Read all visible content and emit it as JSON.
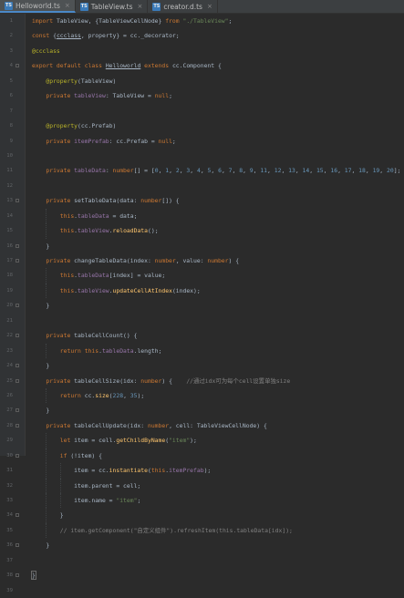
{
  "tabs": [
    {
      "icon": "TS",
      "label": "Helloworld.ts",
      "active": true
    },
    {
      "icon": "TS",
      "label": "TableView.ts",
      "active": false
    },
    {
      "icon": "TS",
      "label": "creator.d.ts",
      "active": false
    }
  ],
  "code_lines": [
    {
      "n": "1",
      "tokens": [
        [
          "kw",
          "import"
        ],
        [
          "p",
          " TableView, {TableViewCellNode} "
        ],
        [
          "kw",
          "from"
        ],
        [
          "p",
          " "
        ],
        [
          "str",
          "\"./TableView\""
        ],
        [
          "p",
          ";"
        ]
      ]
    },
    {
      "n": "2",
      "tokens": [
        [
          "kw",
          "const"
        ],
        [
          "p",
          " {"
        ],
        [
          "ul",
          "ccclass"
        ],
        [
          "p",
          ", property} = cc._decorator;"
        ]
      ]
    },
    {
      "n": "3",
      "tokens": [
        [
          "dec",
          "@ccclass"
        ]
      ]
    },
    {
      "n": "4",
      "tokens": [
        [
          "kw",
          "export default class "
        ],
        [
          "ul",
          "Helloworld"
        ],
        [
          "kw",
          " extends "
        ],
        [
          "p",
          "cc.Component {"
        ]
      ]
    },
    {
      "n": "5",
      "tokens": [
        [
          "p",
          "    "
        ],
        [
          "dec",
          "@property"
        ],
        [
          "p",
          "(TableView)"
        ]
      ]
    },
    {
      "n": "6",
      "tokens": [
        [
          "p",
          "    "
        ],
        [
          "kw",
          "private "
        ],
        [
          "prop",
          "tableView"
        ],
        [
          "p",
          ": TableView = "
        ],
        [
          "kw",
          "null"
        ],
        [
          "p",
          ";"
        ]
      ]
    },
    {
      "n": "7",
      "tokens": [
        [
          "p",
          ""
        ]
      ]
    },
    {
      "n": "8",
      "tokens": [
        [
          "p",
          "    "
        ],
        [
          "dec",
          "@property"
        ],
        [
          "p",
          "(cc.Prefab)"
        ]
      ]
    },
    {
      "n": "9",
      "tokens": [
        [
          "p",
          "    "
        ],
        [
          "kw",
          "private "
        ],
        [
          "prop",
          "itemPrefab"
        ],
        [
          "p",
          ": cc.Prefab = "
        ],
        [
          "kw",
          "null"
        ],
        [
          "p",
          ";"
        ]
      ]
    },
    {
      "n": "10",
      "tokens": [
        [
          "p",
          ""
        ]
      ]
    },
    {
      "n": "11",
      "tokens": [
        [
          "p",
          "    "
        ],
        [
          "kw",
          "private "
        ],
        [
          "prop",
          "tableData"
        ],
        [
          "p",
          ": "
        ],
        [
          "kw",
          "number"
        ],
        [
          "p",
          "[] = ["
        ],
        [
          "num",
          "0"
        ],
        [
          "p",
          ", "
        ],
        [
          "num",
          "1"
        ],
        [
          "p",
          ", "
        ],
        [
          "num",
          "2"
        ],
        [
          "p",
          ", "
        ],
        [
          "num",
          "3"
        ],
        [
          "p",
          ", "
        ],
        [
          "num",
          "4"
        ],
        [
          "p",
          ", "
        ],
        [
          "num",
          "5"
        ],
        [
          "p",
          ", "
        ],
        [
          "num",
          "6"
        ],
        [
          "p",
          ", "
        ],
        [
          "num",
          "7"
        ],
        [
          "p",
          ", "
        ],
        [
          "num",
          "8"
        ],
        [
          "p",
          ", "
        ],
        [
          "num",
          "9"
        ],
        [
          "p",
          ", "
        ],
        [
          "num",
          "11"
        ],
        [
          "p",
          ", "
        ],
        [
          "num",
          "12"
        ],
        [
          "p",
          ", "
        ],
        [
          "num",
          "13"
        ],
        [
          "p",
          ", "
        ],
        [
          "num",
          "14"
        ],
        [
          "p",
          ", "
        ],
        [
          "num",
          "15"
        ],
        [
          "p",
          ", "
        ],
        [
          "num",
          "16"
        ],
        [
          "p",
          ", "
        ],
        [
          "num",
          "17"
        ],
        [
          "p",
          ", "
        ],
        [
          "num",
          "18"
        ],
        [
          "p",
          ", "
        ],
        [
          "num",
          "19"
        ],
        [
          "p",
          ", "
        ],
        [
          "num",
          "20"
        ],
        [
          "p",
          "];"
        ]
      ]
    },
    {
      "n": "12",
      "tokens": [
        [
          "p",
          ""
        ]
      ]
    },
    {
      "n": "13",
      "tokens": [
        [
          "p",
          "    "
        ],
        [
          "kw",
          "private "
        ],
        [
          "p",
          "setTableData(data: "
        ],
        [
          "kw",
          "number"
        ],
        [
          "p",
          "[]) {"
        ]
      ]
    },
    {
      "n": "14",
      "tokens": [
        [
          "p",
          "        "
        ],
        [
          "kw",
          "this"
        ],
        [
          "p",
          "."
        ],
        [
          "prop",
          "tableData"
        ],
        [
          "p",
          " = data;"
        ]
      ]
    },
    {
      "n": "15",
      "tokens": [
        [
          "p",
          "        "
        ],
        [
          "kw",
          "this"
        ],
        [
          "p",
          "."
        ],
        [
          "prop",
          "tableView"
        ],
        [
          "p",
          "."
        ],
        [
          "fn",
          "reloadData"
        ],
        [
          "p",
          "();"
        ]
      ]
    },
    {
      "n": "16",
      "tokens": [
        [
          "p",
          "    }"
        ]
      ]
    },
    {
      "n": "17",
      "tokens": [
        [
          "p",
          "    "
        ],
        [
          "kw",
          "private "
        ],
        [
          "p",
          "changeTableData(index: "
        ],
        [
          "kw",
          "number"
        ],
        [
          "p",
          ", value: "
        ],
        [
          "kw",
          "number"
        ],
        [
          "p",
          ") {"
        ]
      ]
    },
    {
      "n": "18",
      "tokens": [
        [
          "p",
          "        "
        ],
        [
          "kw",
          "this"
        ],
        [
          "p",
          "."
        ],
        [
          "prop",
          "tableData"
        ],
        [
          "p",
          "[index] = value;"
        ]
      ]
    },
    {
      "n": "19",
      "tokens": [
        [
          "p",
          "        "
        ],
        [
          "kw",
          "this"
        ],
        [
          "p",
          "."
        ],
        [
          "prop",
          "tableView"
        ],
        [
          "p",
          "."
        ],
        [
          "fn",
          "updateCellAtIndex"
        ],
        [
          "p",
          "(index);"
        ]
      ]
    },
    {
      "n": "20",
      "tokens": [
        [
          "p",
          "    }"
        ]
      ]
    },
    {
      "n": "21",
      "tokens": [
        [
          "p",
          ""
        ]
      ]
    },
    {
      "n": "22",
      "tokens": [
        [
          "p",
          "    "
        ],
        [
          "kw",
          "private "
        ],
        [
          "p",
          "tableCellCount() {"
        ]
      ]
    },
    {
      "n": "23",
      "tokens": [
        [
          "p",
          "        "
        ],
        [
          "kw",
          "return this"
        ],
        [
          "p",
          "."
        ],
        [
          "prop",
          "tableData"
        ],
        [
          "p",
          ".length;"
        ]
      ]
    },
    {
      "n": "24",
      "tokens": [
        [
          "p",
          "    }"
        ]
      ]
    },
    {
      "n": "25",
      "tokens": [
        [
          "p",
          "    "
        ],
        [
          "kw",
          "private "
        ],
        [
          "p",
          "tableCellSize(idx: "
        ],
        [
          "kw",
          "number"
        ],
        [
          "p",
          ") {    "
        ],
        [
          "cmt",
          "//通过idx可为每个cell设置单独size"
        ]
      ]
    },
    {
      "n": "26",
      "tokens": [
        [
          "p",
          "        "
        ],
        [
          "kw",
          "return "
        ],
        [
          "p",
          "cc."
        ],
        [
          "fn",
          "size"
        ],
        [
          "p",
          "("
        ],
        [
          "num",
          "228"
        ],
        [
          "p",
          ", "
        ],
        [
          "num",
          "35"
        ],
        [
          "p",
          ");"
        ]
      ]
    },
    {
      "n": "27",
      "tokens": [
        [
          "p",
          "    }"
        ]
      ]
    },
    {
      "n": "28",
      "tokens": [
        [
          "p",
          "    "
        ],
        [
          "kw",
          "private "
        ],
        [
          "p",
          "tableCellUpdate(idx: "
        ],
        [
          "kw",
          "number"
        ],
        [
          "p",
          ", cell: TableViewCellNode) {"
        ]
      ]
    },
    {
      "n": "29",
      "tokens": [
        [
          "p",
          "        "
        ],
        [
          "kw",
          "let "
        ],
        [
          "p",
          "item = cell."
        ],
        [
          "fn",
          "getChildByName"
        ],
        [
          "p",
          "("
        ],
        [
          "str",
          "\"item\""
        ],
        [
          "p",
          ");"
        ]
      ]
    },
    {
      "n": "30",
      "tokens": [
        [
          "p",
          "        "
        ],
        [
          "kw",
          "if "
        ],
        [
          "p",
          "(!item) {"
        ]
      ]
    },
    {
      "n": "31",
      "tokens": [
        [
          "p",
          "            item = cc."
        ],
        [
          "fn",
          "instantiate"
        ],
        [
          "p",
          "("
        ],
        [
          "kw",
          "this"
        ],
        [
          "p",
          "."
        ],
        [
          "prop",
          "itemPrefab"
        ],
        [
          "p",
          ");"
        ]
      ]
    },
    {
      "n": "32",
      "tokens": [
        [
          "p",
          "            item.parent = cell;"
        ]
      ]
    },
    {
      "n": "33",
      "tokens": [
        [
          "p",
          "            item.name = "
        ],
        [
          "str",
          "\"item\""
        ],
        [
          "p",
          ";"
        ]
      ]
    },
    {
      "n": "34",
      "tokens": [
        [
          "p",
          "        }"
        ]
      ]
    },
    {
      "n": "35",
      "tokens": [
        [
          "p",
          "        "
        ],
        [
          "cmt",
          "// item.getComponent(\"自定义组件\").refreshItem(this.tableData[idx]);"
        ]
      ]
    },
    {
      "n": "36",
      "tokens": [
        [
          "p",
          "    }"
        ]
      ]
    },
    {
      "n": "37",
      "tokens": [
        [
          "p",
          ""
        ]
      ]
    },
    {
      "n": "38",
      "tokens": [
        [
          "p",
          "}"
        ]
      ]
    },
    {
      "n": "39",
      "tokens": [
        [
          "p",
          ""
        ]
      ]
    }
  ],
  "colors": {
    "background": "#2b2b2b",
    "keyword": "#cc7832",
    "string": "#6a8759",
    "number": "#6897bb",
    "property": "#9876aa",
    "function": "#ffc66d",
    "decorator": "#bbb529",
    "comment": "#808080",
    "plain": "#a9b7c6"
  }
}
